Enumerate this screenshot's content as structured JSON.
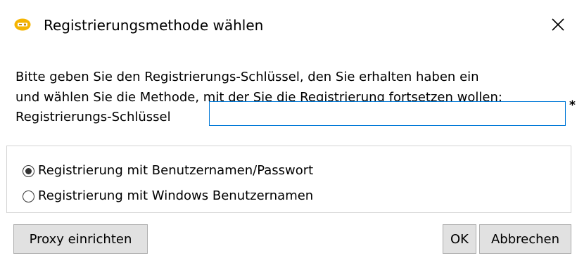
{
  "window": {
    "title": "Registrierungsmethode wählen",
    "app_icon": "registration-app-icon",
    "close_icon": "close-icon"
  },
  "instructions": {
    "line1": "Bitte geben Sie den Registrierungs-Schlüssel, den Sie erhalten haben ein",
    "line2": "und wählen Sie die Methode, mit der Sie die Registrierung fortsetzen wollen:"
  },
  "key_field": {
    "label": "Registrierungs-Schlüssel",
    "value": "",
    "required_mark": "*"
  },
  "method": {
    "options": [
      {
        "label": "Registrierung mit Benutzernamen/Passwort",
        "selected": true
      },
      {
        "label": "Registrierung mit Windows Benutzernamen",
        "selected": false
      }
    ]
  },
  "buttons": {
    "proxy": "Proxy einrichten",
    "ok": "OK",
    "cancel": "Abbrechen"
  },
  "colors": {
    "accent": "#0078d7",
    "icon_yellow": "#f5b400",
    "button_bg": "#e1e1e1",
    "button_border": "#adadad",
    "group_border": "#d4d4d4"
  }
}
